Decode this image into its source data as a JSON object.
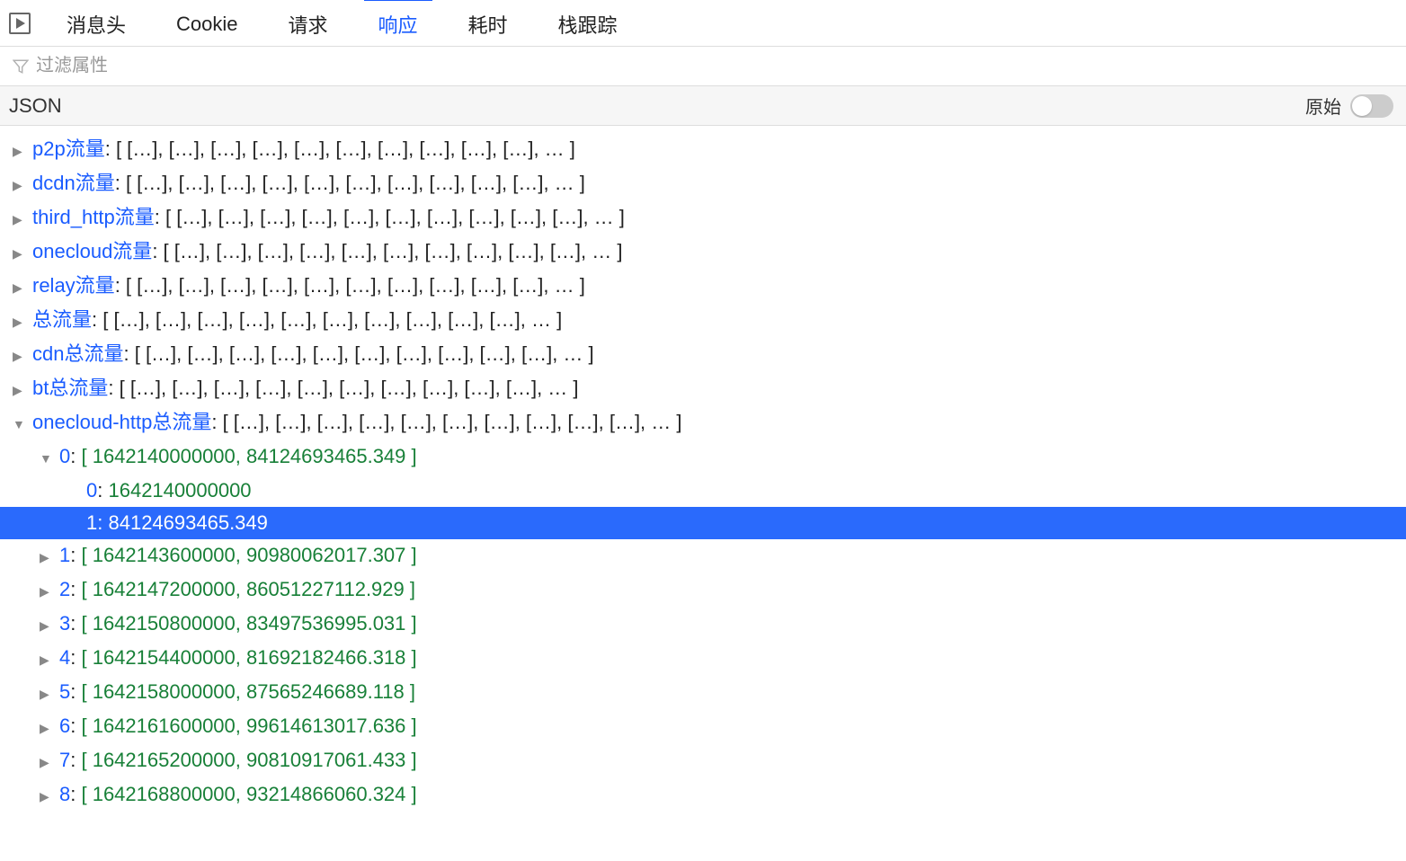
{
  "tabs": {
    "headers": "消息头",
    "cookie": "Cookie",
    "request": "请求",
    "response": "响应",
    "timing": "耗时",
    "stack": "栈跟踪",
    "active": "response"
  },
  "filter": {
    "placeholder": "过滤属性"
  },
  "jsonHeader": {
    "label": "JSON",
    "rawLabel": "原始"
  },
  "collapsedArrayPreview": "[ […], […], […], […], […], […], […], […], […], […], … ]",
  "topKeys": [
    "p2p流量",
    "dcdn流量",
    "third_http流量",
    "onecloud流量",
    "relay流量",
    "总流量",
    "cdn总流量",
    "bt总流量"
  ],
  "expandedKey": "onecloud-http总流量",
  "expanded0": {
    "index": "0",
    "pair": "[ 1642140000000, 84124693465.349 ]",
    "item0Idx": "0",
    "item0Val": "1642140000000",
    "item1Idx": "1",
    "item1Val": "84124693465.349"
  },
  "children": [
    {
      "idx": "1",
      "pair": "[ 1642143600000, 90980062017.307 ]"
    },
    {
      "idx": "2",
      "pair": "[ 1642147200000, 86051227112.929 ]"
    },
    {
      "idx": "3",
      "pair": "[ 1642150800000, 83497536995.031 ]"
    },
    {
      "idx": "4",
      "pair": "[ 1642154400000, 81692182466.318 ]"
    },
    {
      "idx": "5",
      "pair": "[ 1642158000000, 87565246689.118 ]"
    },
    {
      "idx": "6",
      "pair": "[ 1642161600000, 99614613017.636 ]"
    },
    {
      "idx": "7",
      "pair": "[ 1642165200000, 90810917061.433 ]"
    },
    {
      "idx": "8",
      "pair": "[ 1642168800000, 93214866060.324 ]"
    }
  ]
}
